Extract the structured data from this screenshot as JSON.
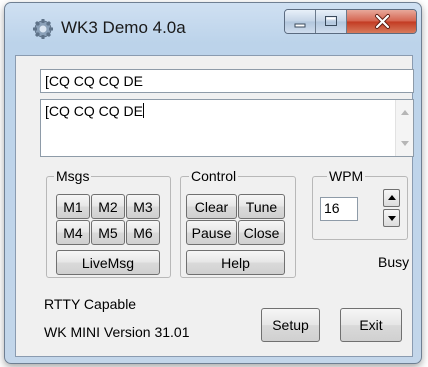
{
  "window": {
    "title": "WK3 Demo 4.0a",
    "icon": "gear-icon",
    "title_buttons": [
      "minimize-icon",
      "maximize-icon",
      "close-icon"
    ]
  },
  "fields": {
    "send_text": "[CQ CQ CQ DE",
    "buffer_text": "[CQ CQ CQ DE"
  },
  "msgs": {
    "label": "Msgs",
    "buttons": [
      "M1",
      "M2",
      "M3",
      "M4",
      "M5",
      "M6"
    ],
    "live": "LiveMsg"
  },
  "control": {
    "label": "Control",
    "clear": "Clear",
    "tune": "Tune",
    "pause": "Pause",
    "close": "Close",
    "help": "Help"
  },
  "wpm": {
    "label": "WPM",
    "value": "16"
  },
  "status": {
    "busy": "Busy",
    "rtty": "RTTY Capable",
    "version": "WK MINI Version 31.01"
  },
  "actions": {
    "setup": "Setup",
    "exit": "Exit"
  },
  "colors": {
    "close_button": "#c23a22",
    "frame": "#bcd3ea",
    "client": "#f0f0f0"
  }
}
